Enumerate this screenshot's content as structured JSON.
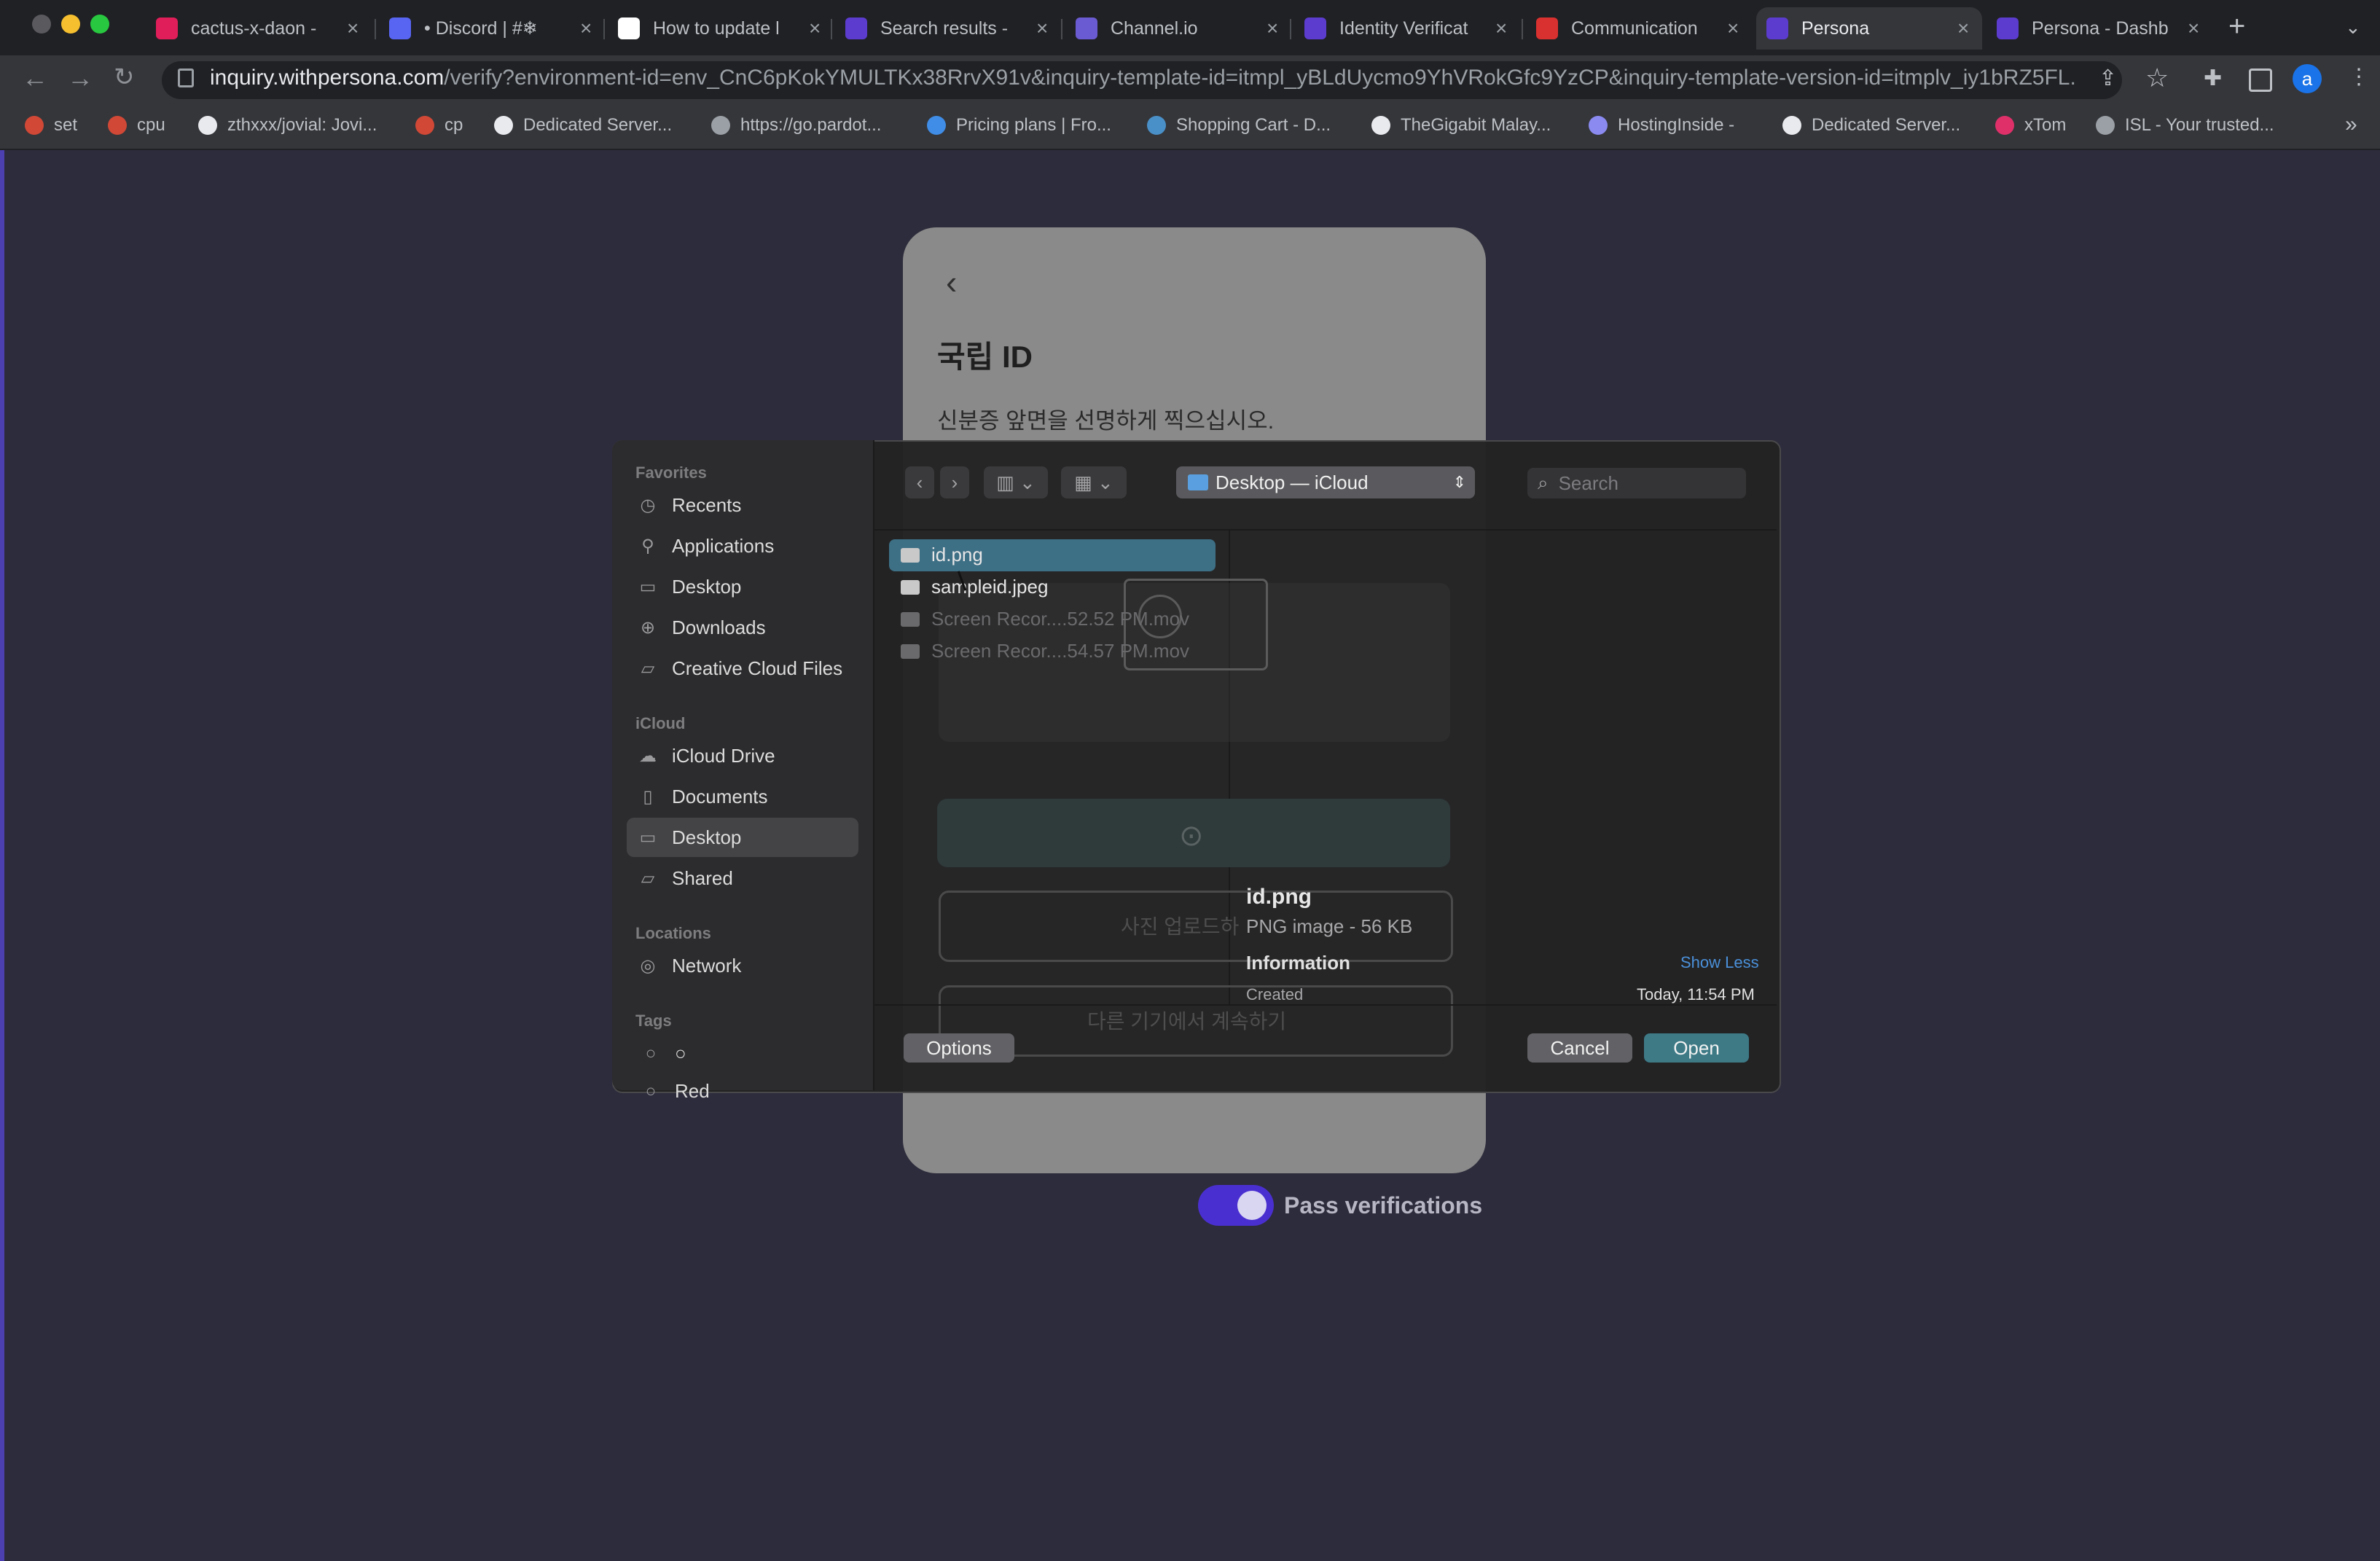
{
  "browser": {
    "tabs": [
      {
        "title": "cactus-x-daon -",
        "favicon_color": "#e01e5a",
        "favicon": "slack-icon"
      },
      {
        "title": "• Discord | #❄",
        "favicon_color": "#5865f2",
        "favicon": "discord-icon"
      },
      {
        "title": "How to update l",
        "favicon_color": "#ffffff",
        "favicon": "notion-icon"
      },
      {
        "title": "Search results -",
        "favicon_color": "#5b3ccf",
        "favicon": "persona-icon"
      },
      {
        "title": "Channel.io",
        "favicon_color": "#6b5bd2",
        "favicon": "channelio-icon"
      },
      {
        "title": "Identity Verificat",
        "favicon_color": "#5b3ccf",
        "favicon": "persona-icon"
      },
      {
        "title": "Communication",
        "favicon_color": "#d93030",
        "favicon": "communication-icon"
      },
      {
        "title": "Persona",
        "favicon_color": "#5b3ccf",
        "favicon": "persona-icon"
      },
      {
        "title": "Persona - Dashb",
        "favicon_color": "#5b3ccf",
        "favicon": "persona-icon"
      }
    ],
    "active_tab": 7,
    "url_host": "inquiry.withpersona.com",
    "url_path": "/verify?environment-id=env_CnC6pKokYMULTKx38RrvX91v&inquiry-template-id=itmpl_yBLdUycmo9YhVRokGfc9YzCP&inquiry-template-version-id=itmplv_iy1bRZ5FL...",
    "profile_initial": "a",
    "bookmarks": [
      {
        "label": "set",
        "color": "#d14836"
      },
      {
        "label": "cpu",
        "color": "#d14836"
      },
      {
        "label": "zthxxx/jovial: Jovi...",
        "color": "#e8eaed"
      },
      {
        "label": "cp",
        "color": "#d14836"
      },
      {
        "label": "Dedicated Server...",
        "color": "#e8eaed"
      },
      {
        "label": "https://go.pardot...",
        "color": "#9aa0a6"
      },
      {
        "label": "Pricing plans | Fro...",
        "color": "#3f8de6"
      },
      {
        "label": "Shopping Cart - D...",
        "color": "#4a90c8"
      },
      {
        "label": "TheGigabit Malay...",
        "color": "#e8eaed"
      },
      {
        "label": "HostingInside -",
        "color": "#8a8af0"
      },
      {
        "label": "Dedicated Server...",
        "color": "#e8eaed"
      },
      {
        "label": "xTom",
        "color": "#e0306a"
      },
      {
        "label": "ISL - Your trusted...",
        "color": "#9aa0a6"
      }
    ],
    "bookmarks_overflow": "»"
  },
  "card": {
    "back": "‹",
    "title": "국립 ID",
    "subtitle": "신분증 앞면을 선명하게 찍으십시오.",
    "upload_label": "사진 업로드하",
    "other_device_label": "다른 기기에서 계속하기"
  },
  "toggle": {
    "label": "Pass verifications",
    "on": true
  },
  "dialog": {
    "sidebar": {
      "favorites_heading": "Favorites",
      "favorites": [
        {
          "label": "Recents",
          "icon": "clock-icon"
        },
        {
          "label": "Applications",
          "icon": "applications-icon"
        },
        {
          "label": "Desktop",
          "icon": "desktop-icon"
        },
        {
          "label": "Downloads",
          "icon": "downloads-icon"
        },
        {
          "label": "Creative Cloud Files",
          "icon": "folder-icon"
        }
      ],
      "icloud_heading": "iCloud",
      "icloud": [
        {
          "label": "iCloud Drive",
          "icon": "cloud-icon"
        },
        {
          "label": "Documents",
          "icon": "document-icon"
        },
        {
          "label": "Desktop",
          "icon": "desktop-icon"
        },
        {
          "label": "Shared",
          "icon": "shared-folder-icon"
        }
      ],
      "locations_heading": "Locations",
      "locations": [
        {
          "label": "Network",
          "icon": "globe-icon"
        }
      ],
      "tags_heading": "Tags",
      "tags": [
        {
          "label": "○"
        },
        {
          "label": "Red"
        }
      ]
    },
    "location": "Desktop — iCloud",
    "search_placeholder": "Search",
    "files": [
      {
        "name": "id.png",
        "selected": true,
        "dimmed": false
      },
      {
        "name": "sampleid.jpeg",
        "selected": false,
        "dimmed": false
      },
      {
        "name": "Screen Recor....52.52 PM.mov",
        "selected": false,
        "dimmed": true
      },
      {
        "name": "Screen Recor....54.57 PM.mov",
        "selected": false,
        "dimmed": true
      }
    ],
    "preview": {
      "name": "id.png",
      "kind": "PNG image - 56 KB",
      "info_heading": "Information",
      "show_less": "Show Less",
      "created_label": "Created",
      "created_value": "Today, 11:54 PM"
    },
    "options_label": "Options",
    "cancel_label": "Cancel",
    "open_label": "Open",
    "accent": "#3d6f85"
  }
}
